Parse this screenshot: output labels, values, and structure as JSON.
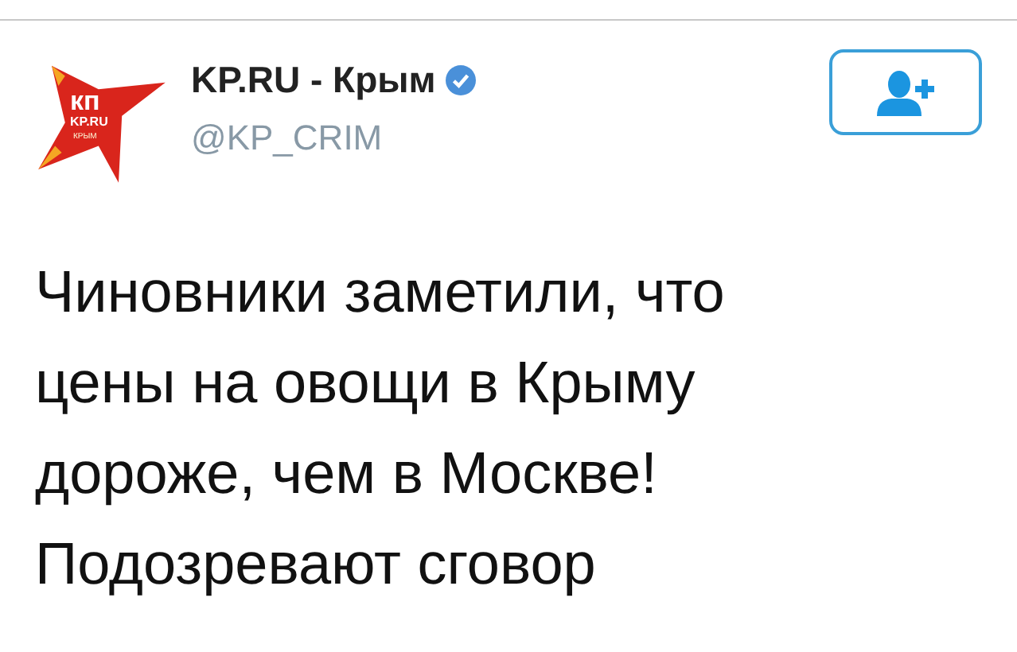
{
  "account": {
    "logo": {
      "big": "кп",
      "small": "KP.RU",
      "region": "КРЫМ"
    },
    "name": "KP.RU - Крым",
    "verified": true,
    "handle": "@KP_CRIM"
  },
  "follow_button": {
    "selected": false
  },
  "tweet": {
    "lines": [
      "Чиновники заметили, что",
      "цены на овощи в Крыму",
      "дороже, чем в Москве!",
      "Подозревают сговор"
    ]
  }
}
